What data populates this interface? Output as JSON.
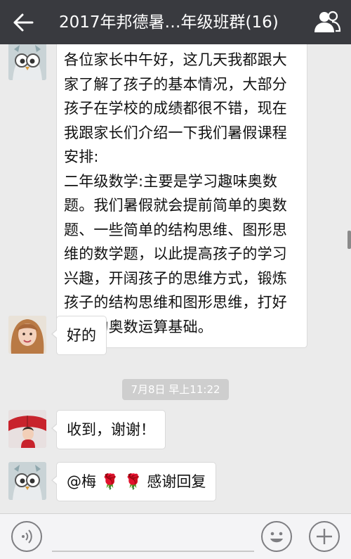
{
  "header": {
    "title": "2017年邦德暑…年级班群(16)",
    "back_icon": "back-arrow-icon",
    "contacts_icon": "group-members-icon",
    "bg_color": "#393a3f"
  },
  "messages": [
    {
      "sender_avatar": "owl-avatar",
      "text": "各位家长中午好，这几天我都跟大家了解了孩子的基本情况，大部分孩子在学校的成绩都很不错，现在我跟家长们介绍一下我们暑假课程安排:\n二年级数学:主要是学习趣味奥数题。我们暑假就会提前简单的奥数题、一些简单的结构思维、图形思维的数学题，以此提高孩子的学习兴趣，开阔孩子的思维方式，锻炼孩子的结构思维和图形思维，打好基本的奥数运算基础。"
    },
    {
      "sender_avatar": "woman-avatar",
      "text": "好的"
    },
    {
      "sender_avatar": "girl-avatar",
      "text": "收到，谢谢！"
    },
    {
      "sender_avatar": "owl-avatar",
      "text": "@梅 🌹 🌹 感谢回复"
    }
  ],
  "timestamp": "7月8日 早上11:22",
  "input_bar": {
    "voice_icon": "voice-icon",
    "emoji_icon": "emoji-icon",
    "plus_icon": "plus-icon",
    "message_value": ""
  }
}
